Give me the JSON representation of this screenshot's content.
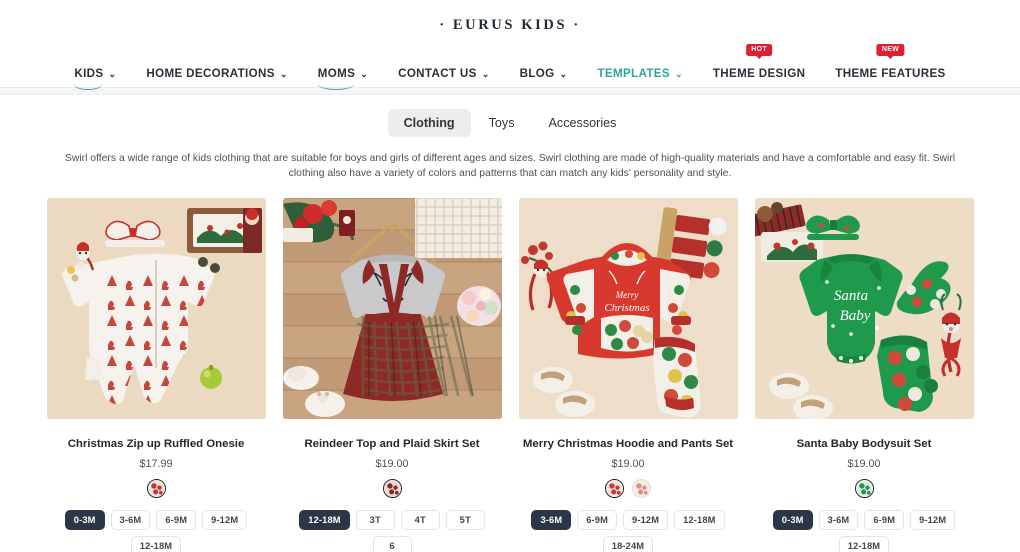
{
  "header": {
    "logo": "· EURUS KIDS ·",
    "nav": [
      {
        "label": "KIDS",
        "caret": true,
        "underline": true,
        "teal": false,
        "badge": null
      },
      {
        "label": "HOME DECORATIONS",
        "caret": true,
        "underline": false,
        "teal": false,
        "badge": null
      },
      {
        "label": "MOMS",
        "caret": true,
        "underline": true,
        "teal": false,
        "badge": null
      },
      {
        "label": "CONTACT US",
        "caret": true,
        "underline": false,
        "teal": false,
        "badge": null
      },
      {
        "label": "BLOG",
        "caret": true,
        "underline": false,
        "teal": false,
        "badge": null
      },
      {
        "label": "TEMPLATES",
        "caret": true,
        "underline": false,
        "teal": true,
        "badge": null
      },
      {
        "label": "THEME DESIGN",
        "caret": false,
        "underline": false,
        "teal": false,
        "badge": "HOT"
      },
      {
        "label": "THEME FEATURES",
        "caret": false,
        "underline": false,
        "teal": false,
        "badge": "NEW"
      }
    ],
    "caret_glyph": "⌄",
    "accent_color": "#2fa39a",
    "badge_color": "#e01f33"
  },
  "tabs": [
    {
      "label": "Clothing",
      "active": true
    },
    {
      "label": "Toys",
      "active": false
    },
    {
      "label": "Accessories",
      "active": false
    }
  ],
  "description": "Swirl offers a wide range of kids clothing that are suitable for boys and girls of different ages and sizes. Swirl clothing are made of high-quality materials and have a comfortable and easy fit. Swirl clothing also have a variety of colors and patterns that can match any kids' personality and style.",
  "products": [
    {
      "title": "Christmas Zip up Ruffled Onesie",
      "price": "$17.99",
      "image_name": "christmas-zip-up-ruffled-onesie-photo",
      "bg": "#ecd9c2",
      "swatches": [
        {
          "name": "red-white-christmas-print",
          "color": "#f0e4dc",
          "accent": "#c3372f",
          "selected": true
        }
      ],
      "sizes": [
        {
          "label": "0-3M",
          "selected": true
        },
        {
          "label": "3-6M",
          "selected": false
        },
        {
          "label": "6-9M",
          "selected": false
        },
        {
          "label": "9-12M",
          "selected": false
        },
        {
          "label": "12-18M",
          "selected": false
        }
      ]
    },
    {
      "title": "Reindeer Top and Plaid Skirt Set",
      "price": "$19.00",
      "image_name": "reindeer-top-and-plaid-skirt-set-photo",
      "bg": "#c7a684",
      "swatches": [
        {
          "name": "grey-red-plaid",
          "color": "#e8ded7",
          "accent": "#8e2a25",
          "selected": true
        }
      ],
      "sizes": [
        {
          "label": "12-18M",
          "selected": true
        },
        {
          "label": "3T",
          "selected": false
        },
        {
          "label": "4T",
          "selected": false
        },
        {
          "label": "5T",
          "selected": false
        },
        {
          "label": "6",
          "selected": false
        }
      ]
    },
    {
      "title": "Merry Christmas Hoodie and Pants Set",
      "price": "$19.00",
      "image_name": "merry-christmas-hoodie-and-pants-set-photo",
      "bg": "#eeddc8",
      "swatches": [
        {
          "name": "red-christmas-print",
          "color": "#f3e7e0",
          "accent": "#d03a33",
          "selected": true
        },
        {
          "name": "pink-christmas-print",
          "color": "#f7ece8",
          "accent": "#d98f86",
          "selected": false
        }
      ],
      "sizes": [
        {
          "label": "3-6M",
          "selected": true
        },
        {
          "label": "6-9M",
          "selected": false
        },
        {
          "label": "9-12M",
          "selected": false
        },
        {
          "label": "12-18M",
          "selected": false
        },
        {
          "label": "18-24M",
          "selected": false
        }
      ]
    },
    {
      "title": "Santa Baby Bodysuit Set",
      "price": "$19.00",
      "image_name": "santa-baby-bodysuit-set-photo",
      "bg": "#eddcc6",
      "swatches": [
        {
          "name": "green-santa-print",
          "color": "#e9efe6",
          "accent": "#1f9a4d",
          "selected": true
        }
      ],
      "sizes": [
        {
          "label": "0-3M",
          "selected": true
        },
        {
          "label": "3-6M",
          "selected": false
        },
        {
          "label": "6-9M",
          "selected": false
        },
        {
          "label": "9-12M",
          "selected": false
        },
        {
          "label": "12-18M",
          "selected": false
        }
      ]
    }
  ]
}
